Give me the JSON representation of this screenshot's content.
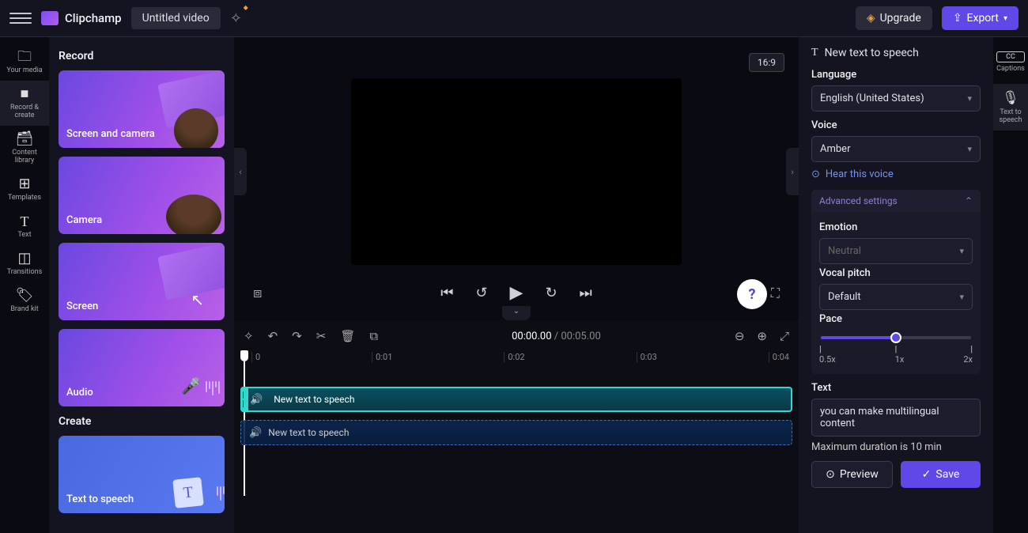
{
  "header": {
    "brand": "Clipchamp",
    "title": "Untitled video",
    "upgrade": "Upgrade",
    "export": "Export"
  },
  "iconbar": [
    {
      "label": "Your media",
      "icon": "🗀"
    },
    {
      "label": "Record & create",
      "icon": "📹",
      "active": true
    },
    {
      "label": "Content library",
      "icon": "🗃"
    },
    {
      "label": "Templates",
      "icon": "⊞"
    },
    {
      "label": "Text",
      "icon": "T"
    },
    {
      "label": "Transitions",
      "icon": "◫"
    },
    {
      "label": "Brand kit",
      "icon": "🏷"
    }
  ],
  "record_panel": {
    "record_heading": "Record",
    "create_heading": "Create",
    "cards": {
      "screen_camera": "Screen and camera",
      "camera": "Camera",
      "screen": "Screen",
      "audio": "Audio",
      "tts": "Text to speech"
    }
  },
  "preview": {
    "ratio": "16:9",
    "time_current": "00:00.00",
    "time_duration": "00:05.00"
  },
  "ruler": [
    "0",
    "0:01",
    "0:02",
    "0:03",
    "0:04"
  ],
  "clips": {
    "clip1": "New text to speech",
    "clip2": "New text to speech"
  },
  "tts_panel": {
    "title": "New text to speech",
    "language_label": "Language",
    "language_value": "English (United States)",
    "voice_label": "Voice",
    "voice_value": "Amber",
    "hear": "Hear this voice",
    "advanced": "Advanced settings",
    "emotion_label": "Emotion",
    "emotion_value": "Neutral",
    "pitch_label": "Vocal pitch",
    "pitch_value": "Default",
    "pace_label": "Pace",
    "pace_min": "0.5x",
    "pace_mid": "1x",
    "pace_max": "2x",
    "text_label": "Text",
    "text_value": "you can make multilingual content",
    "max_duration": "Maximum duration is 10 min",
    "preview_btn": "Preview",
    "save_btn": "Save"
  },
  "dock_right": [
    {
      "label": "Captions",
      "icon": "CC"
    },
    {
      "label": "Text to speech",
      "icon": "🎙",
      "active": true
    }
  ]
}
